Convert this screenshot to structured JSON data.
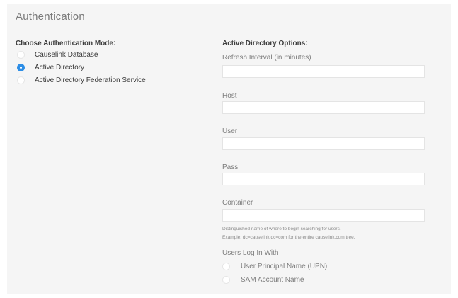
{
  "title": "Authentication",
  "mode": {
    "heading": "Choose Authentication Mode:",
    "options": [
      {
        "label": "Causelink Database",
        "selected": false
      },
      {
        "label": "Active Directory",
        "selected": true
      },
      {
        "label": "Active Directory Federation Service",
        "selected": false
      }
    ]
  },
  "ad_options": {
    "heading": "Active Directory Options:",
    "fields": [
      {
        "label": "Refresh Interval (in minutes)",
        "value": ""
      },
      {
        "label": "Host",
        "value": ""
      },
      {
        "label": "User",
        "value": ""
      },
      {
        "label": "Pass",
        "value": ""
      },
      {
        "label": "Container",
        "value": ""
      }
    ],
    "container_help": [
      "Distinguished name of where to begin searching for users.",
      "Example: dc=causelink,dc=com for the entire causelink.com tree."
    ],
    "login_with": {
      "label": "Users Log In With",
      "options": [
        {
          "label": "User Principal Name (UPN)",
          "selected": false
        },
        {
          "label": "SAM Account Name",
          "selected": false
        }
      ]
    }
  },
  "colors": {
    "accent": "#2d8ee6",
    "panel_bg": "#f5f5f5"
  }
}
